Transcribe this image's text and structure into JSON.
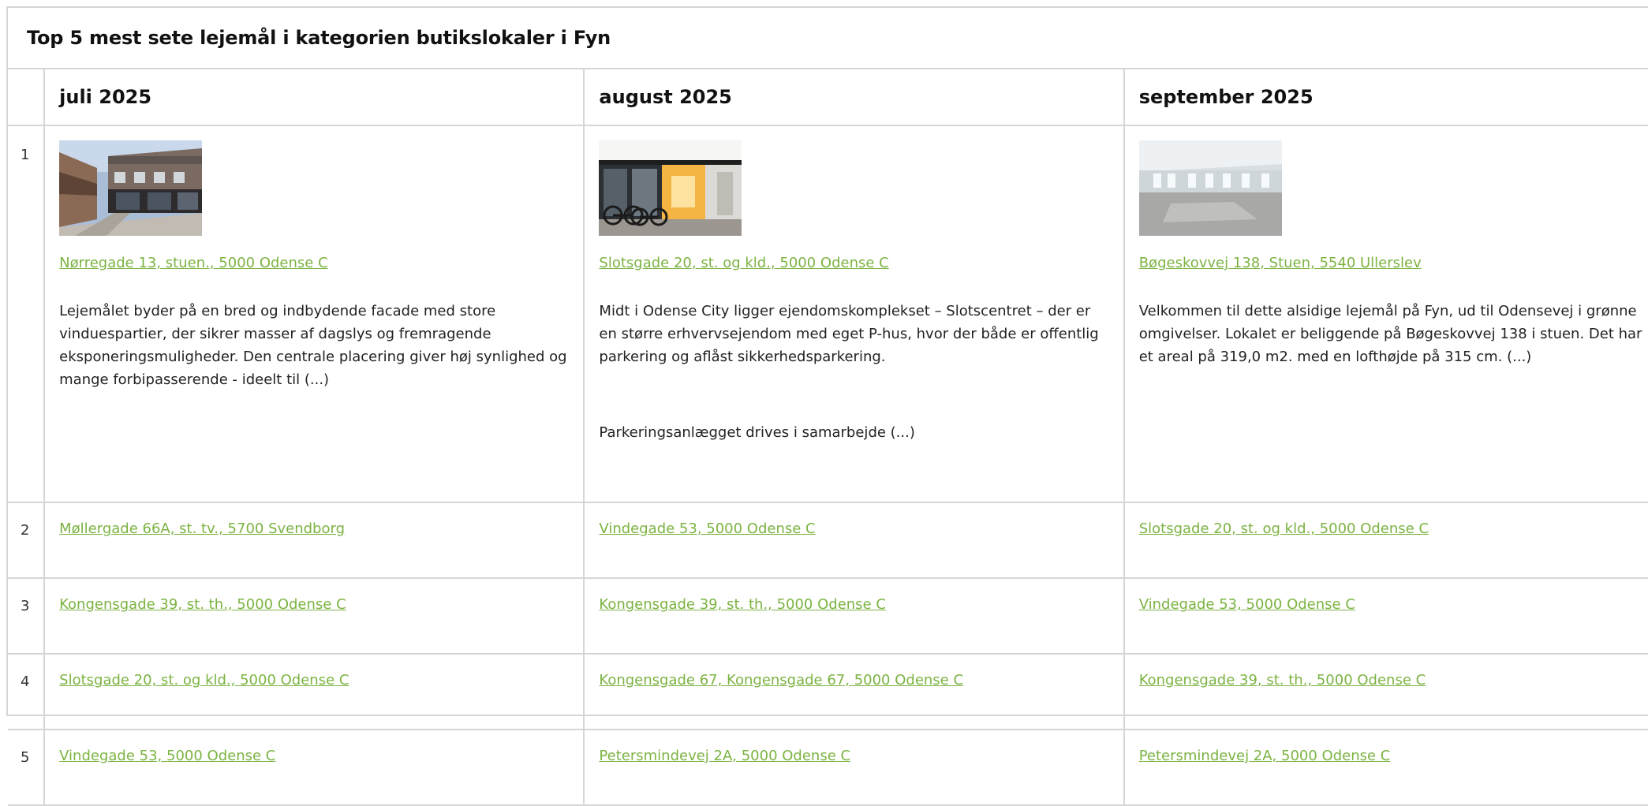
{
  "title": "Top 5 mest sete lejemål i kategorien butikslokaler i Fyn",
  "months": [
    "juli 2025",
    "august 2025",
    "september 2025"
  ],
  "ranks": [
    "1",
    "2",
    "3",
    "4",
    "5"
  ],
  "top": [
    {
      "address": "Nørregade 13, stuen., 5000 Odense C",
      "thumbnail_icon": "street-storefront-photo",
      "desc": [
        "Lejemålet byder på en bred og indbydende facade med store vinduespartier, der sikrer masser af dagslys og fremragende eksponeringsmuligheder. Den centrale placering giver høj synlighed og mange forbipasserende - ideelt til (...)"
      ]
    },
    {
      "address": "Slotsgade 20, st. og kld., 5000 Odense C",
      "thumbnail_icon": "shopfront-bicycles-photo",
      "desc": [
        "Midt i Odense City ligger ejendomskomplekset – Slotscentret – der er en større erhvervsejendom med eget P-hus, hvor der både er offentlig parkering og aflåst sikkerhedsparkering.",
        "Parkeringsanlægget drives i samarbejde (...)"
      ]
    },
    {
      "address": "Bøgeskovvej 138, Stuen, 5540 Ullerslev",
      "thumbnail_icon": "empty-interior-photo",
      "desc": [
        "Velkommen til dette alsidige lejemål på Fyn, ud til Odensevej i grønne omgivelser. Lokalet er beliggende på Bøgeskovvej 138 i stuen. Det har et areal på 319,0 m2. med en lofthøjde på 315 cm. (...)"
      ]
    }
  ],
  "rows": [
    [
      "Møllergade 66A, st. tv., 5700 Svendborg",
      "Vindegade 53, 5000 Odense C",
      "Slotsgade 20, st. og kld., 5000 Odense C"
    ],
    [
      "Kongensgade 39, st. th., 5000 Odense C",
      "Kongensgade 39, st. th., 5000 Odense C",
      "Vindegade 53, 5000 Odense C"
    ],
    [
      "Slotsgade 20, st. og kld., 5000 Odense C",
      "Kongensgade 67, Kongensgade 67, 5000 Odense C",
      "Kongensgade 39, st. th., 5000 Odense C"
    ],
    [
      "Vindegade 53, 5000 Odense C",
      "Petersmindevej 2A, 5000 Odense C",
      "Petersmindevej 2A, 5000 Odense C"
    ]
  ],
  "colors": {
    "link": "#7cb342",
    "border": "#d6d6d6",
    "text": "#222222"
  }
}
